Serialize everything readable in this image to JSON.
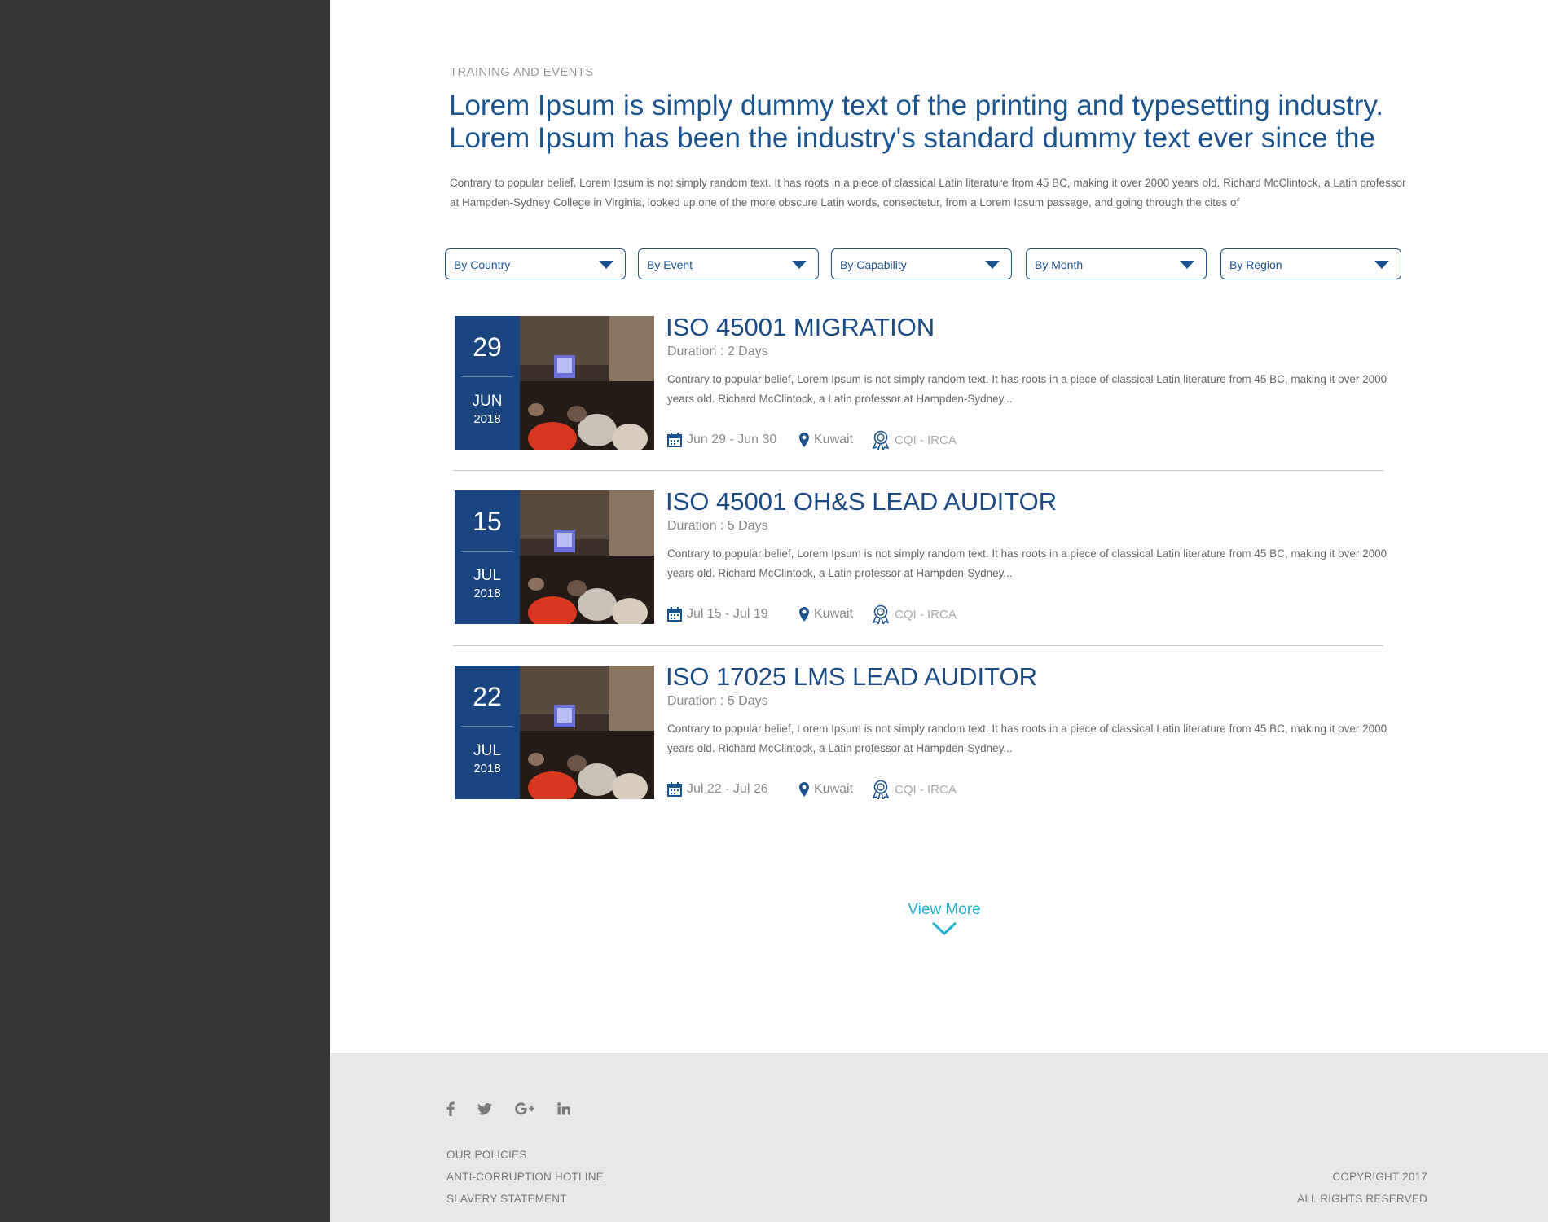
{
  "header": {
    "eyebrow": "TRAINING AND EVENTS",
    "headline": "Lorem Ipsum is simply dummy text of the printing and typesetting industry. Lorem Ipsum has been the industry's standard dummy text ever since the",
    "intro": "Contrary to popular belief, Lorem Ipsum is not simply random text. It has roots in a piece of classical Latin literature from 45 BC, making it over 2000 years old. Richard McClintock, a Latin professor at Hampden-Sydney College in Virginia, looked up one of the more obscure Latin words, consectetur, from a Lorem Ipsum passage, and going through the cites of"
  },
  "filters": [
    {
      "label": "By Country"
    },
    {
      "label": "By Event"
    },
    {
      "label": "By Capability"
    },
    {
      "label": "By Month"
    },
    {
      "label": "By Region"
    }
  ],
  "events": [
    {
      "day": "29",
      "month": "JUN",
      "year": "2018",
      "title": "ISO 45001 MIGRATION",
      "duration": "Duration : 2 Days",
      "description": "Contrary to popular belief, Lorem Ipsum is not simply random text. It has roots in a piece of classical Latin literature from 45 BC, making it over 2000 years old. Richard McClintock, a Latin professor at Hampden-Sydney...",
      "dates": "Jun 29 - Jun 30",
      "location": "Kuwait",
      "accreditation": "CQI - IRCA"
    },
    {
      "day": "15",
      "month": "JUL",
      "year": "2018",
      "title": "ISO 45001 OH&S LEAD AUDITOR",
      "duration": "Duration : 5 Days",
      "description": "Contrary to popular belief, Lorem Ipsum is not simply random text. It has roots in a piece of classical Latin literature from 45 BC, making it over 2000 years old. Richard McClintock, a Latin professor at Hampden-Sydney...",
      "dates": "Jul 15 - Jul 19",
      "location": "Kuwait",
      "accreditation": "CQI - IRCA"
    },
    {
      "day": "22",
      "month": "JUL",
      "year": "2018",
      "title": "ISO 17025 LMS LEAD AUDITOR",
      "duration": "Duration : 5 Days",
      "description": "Contrary to popular belief, Lorem Ipsum is not simply random text. It has roots in a piece of classical Latin literature from 45 BC, making it over 2000 years old. Richard McClintock, a Latin professor at Hampden-Sydney...",
      "dates": "Jul 22 - Jul 26",
      "location": "Kuwait",
      "accreditation": "CQI - IRCA"
    }
  ],
  "view_more": {
    "label": "View More"
  },
  "footer": {
    "social": [
      "facebook-icon",
      "twitter-icon",
      "google-plus-icon",
      "linkedin-icon"
    ],
    "links": [
      "OUR POLICIES",
      "ANTI-CORRUPTION HOTLINE",
      "SLAVERY STATEMENT"
    ],
    "copyright": "COPYRIGHT 2017",
    "rights": "ALL RIGHTS RESERVED"
  },
  "colors": {
    "sidebar": "#363636",
    "brand_blue": "#1b5391",
    "accent_cyan": "#22b1cf",
    "footer_bg": "#e8e8e8"
  }
}
